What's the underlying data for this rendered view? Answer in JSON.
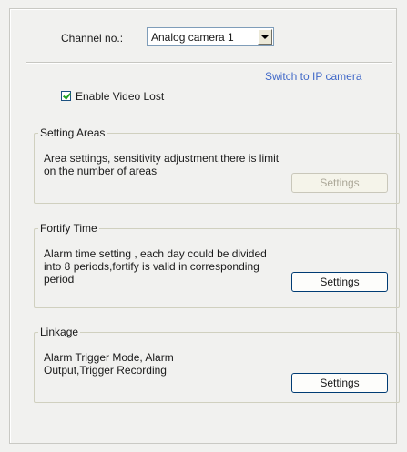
{
  "channel": {
    "label": "Channel no.:",
    "selected": "Analog camera 1"
  },
  "switch_link": "Switch to IP camera",
  "enable_video_lost": {
    "label": "Enable Video Lost",
    "checked": true
  },
  "groups": [
    {
      "title": "Setting Areas",
      "description": "Area settings, sensitivity adjustment,there is limit on the number of areas",
      "button": "Settings",
      "button_enabled": false
    },
    {
      "title": "Fortify Time",
      "description": "Alarm time setting , each day could be divided into 8 periods,fortify is valid in corresponding period",
      "button": "Settings",
      "button_enabled": true
    },
    {
      "title": "Linkage",
      "description": "Alarm Trigger Mode, Alarm Output,Trigger Recording",
      "button": "Settings",
      "button_enabled": true
    }
  ]
}
